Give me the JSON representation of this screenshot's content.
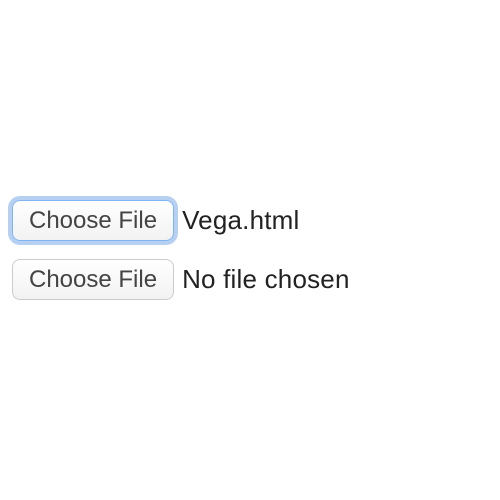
{
  "file_inputs": [
    {
      "button_label": "Choose File",
      "filename": "Vega.html",
      "focused": true
    },
    {
      "button_label": "Choose File",
      "filename": "No file chosen",
      "focused": false
    }
  ]
}
